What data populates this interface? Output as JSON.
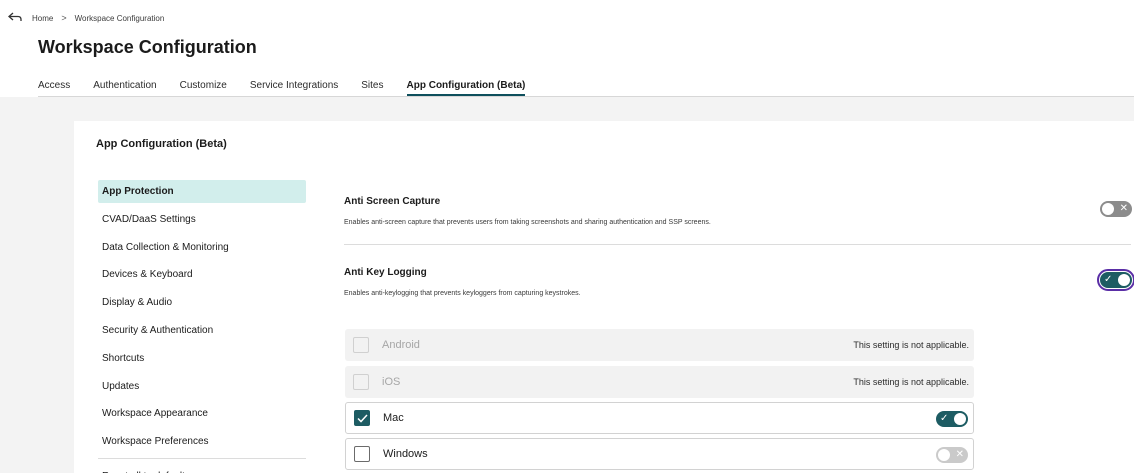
{
  "header": {
    "breadcrumb": [
      "Home",
      "Workspace Configuration"
    ],
    "breadcrumb_separator": ">",
    "title": "Workspace Configuration"
  },
  "tabs": [
    {
      "label": "Access",
      "active": false
    },
    {
      "label": "Authentication",
      "active": false
    },
    {
      "label": "Customize",
      "active": false
    },
    {
      "label": "Service Integrations",
      "active": false
    },
    {
      "label": "Sites",
      "active": false
    },
    {
      "label": "App Configuration (Beta)",
      "active": true
    }
  ],
  "card": {
    "title": "App Configuration (Beta)"
  },
  "sidebar": {
    "items": [
      {
        "label": "App Protection",
        "active": true
      },
      {
        "label": "CVAD/DaaS Settings",
        "active": false
      },
      {
        "label": "Data Collection & Monitoring",
        "active": false
      },
      {
        "label": "Devices & Keyboard",
        "active": false
      },
      {
        "label": "Display & Audio",
        "active": false
      },
      {
        "label": "Security & Authentication",
        "active": false
      },
      {
        "label": "Shortcuts",
        "active": false
      },
      {
        "label": "Updates",
        "active": false
      },
      {
        "label": "Workspace Appearance",
        "active": false
      },
      {
        "label": "Workspace Preferences",
        "active": false
      }
    ],
    "reset_label": "Reset all to default"
  },
  "settings": {
    "anti_screen_capture": {
      "title": "Anti Screen Capture",
      "description": "Enables anti-screen capture that prevents users from taking screenshots and sharing authentication and SSP screens.",
      "enabled": false
    },
    "anti_key_logging": {
      "title": "Anti Key Logging",
      "description": "Enables anti-keylogging that prevents keyloggers from capturing keystrokes.",
      "enabled": true
    }
  },
  "platforms": [
    {
      "label": "Android",
      "applicable": false,
      "checked": false,
      "note": "This setting is not applicable."
    },
    {
      "label": "iOS",
      "applicable": false,
      "checked": false,
      "note": "This setting is not applicable."
    },
    {
      "label": "Mac",
      "applicable": true,
      "checked": true,
      "toggle_on": true
    },
    {
      "label": "Windows",
      "applicable": true,
      "checked": false,
      "toggle_on": false
    }
  ],
  "colors": {
    "accent": "#1d5c63",
    "active_nav_bg": "#d2eeec",
    "toggle_off": "#8c8c8c",
    "focus_outline": "#5a2ea6",
    "page_bg": "#f3f3f3"
  },
  "icons": {
    "back": "back-arrow-icon",
    "check": "checkmark-icon",
    "close": "x-icon"
  }
}
